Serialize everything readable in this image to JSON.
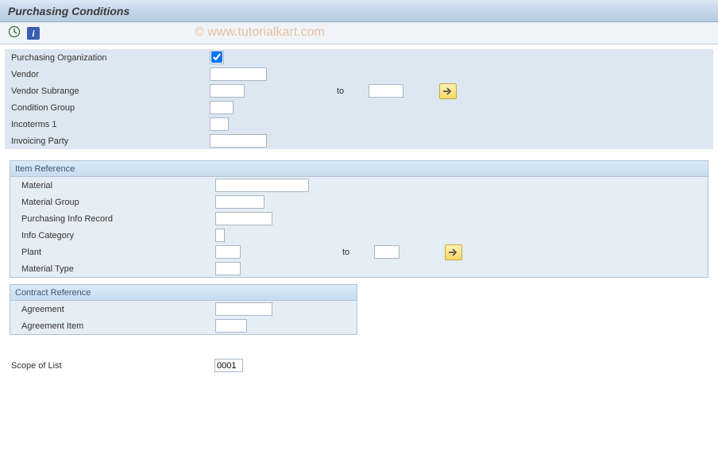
{
  "title": "Purchasing Conditions",
  "watermark": "© www.tutorialkart.com",
  "header": {
    "purch_org_label": "Purchasing Organization",
    "purch_org_checked": true,
    "vendor_label": "Vendor",
    "vendor_value": "",
    "vendor_subrange_label": "Vendor Subrange",
    "vendor_subrange_from": "",
    "vendor_subrange_to": "",
    "to_label": "to",
    "condition_group_label": "Condition Group",
    "condition_group_value": "",
    "incoterms1_label": "Incoterms 1",
    "incoterms1_value": "",
    "invoicing_party_label": "Invoicing Party",
    "invoicing_party_value": ""
  },
  "item_ref": {
    "title": "Item Reference",
    "material_label": "Material",
    "material_value": "",
    "material_group_label": "Material Group",
    "material_group_value": "",
    "purch_info_label": "Purchasing Info Record",
    "purch_info_value": "",
    "info_category_label": "Info Category",
    "info_category_value": "",
    "plant_label": "Plant",
    "plant_from": "",
    "plant_to": "",
    "to_label": "to",
    "material_type_label": "Material Type",
    "material_type_value": ""
  },
  "contract_ref": {
    "title": "Contract Reference",
    "agreement_label": "Agreement",
    "agreement_value": "",
    "agreement_item_label": "Agreement Item",
    "agreement_item_value": ""
  },
  "scope": {
    "label": "Scope of List",
    "value": "0001"
  }
}
